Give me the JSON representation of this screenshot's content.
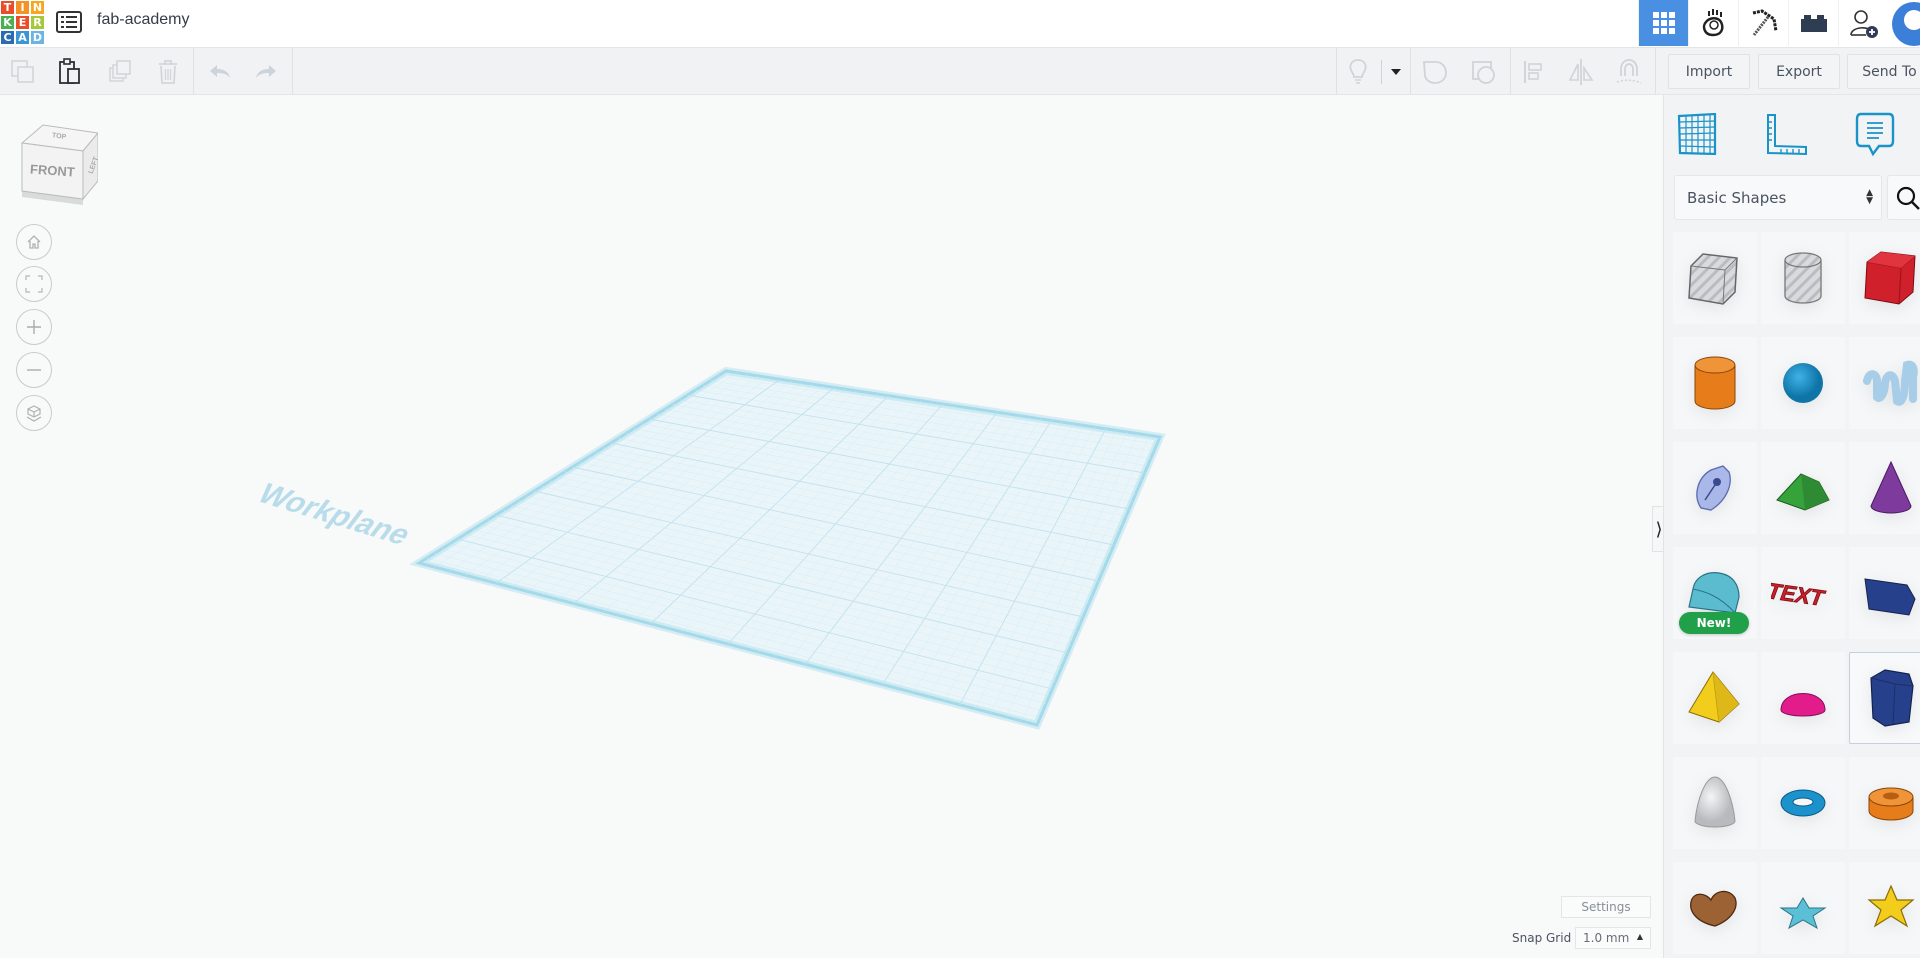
{
  "app": {
    "logo_letters": [
      "T",
      "I",
      "N",
      "K",
      "E",
      "R",
      "C",
      "A",
      "D"
    ],
    "logo_colors": [
      "#e94e2b",
      "#f49324",
      "#f5a623",
      "#4cb050",
      "#e94e2b",
      "#a5c93a",
      "#2b6cb0",
      "#3c96d6",
      "#6cb4e4"
    ],
    "project_title": "fab-academy"
  },
  "header": {
    "buttons": [
      {
        "name": "3d-design-view",
        "icon": "grid-icon",
        "active": true
      },
      {
        "name": "codeblocks-view",
        "icon": "hand-icon",
        "active": false
      },
      {
        "name": "minecraft-view",
        "icon": "pickaxe-icon",
        "active": false
      },
      {
        "name": "lego-view",
        "icon": "brick-icon",
        "active": false
      },
      {
        "name": "invite-user",
        "icon": "add-user-icon",
        "active": false
      }
    ],
    "accent_color": "#4a90e2"
  },
  "toolbar": {
    "copy": "copy",
    "paste": "paste",
    "duplicate": "duplicate",
    "delete": "delete",
    "undo": "undo",
    "redo": "redo",
    "import_label": "Import",
    "export_label": "Export",
    "send_to_label": "Send To"
  },
  "viewport": {
    "viewcube": {
      "front": "FRONT",
      "top": "TOP",
      "right": "LEFT"
    },
    "workplane_label": "Workplane",
    "controls": [
      "home-view",
      "fit-all",
      "zoom-in",
      "zoom-out",
      "ortho-perspective"
    ]
  },
  "panel": {
    "library": "Basic Shapes",
    "new_badge": "New!",
    "shapes": [
      {
        "name": "box-hole",
        "color": "#c4c7cc"
      },
      {
        "name": "cylinder-hole",
        "color": "#c4c7cc"
      },
      {
        "name": "box",
        "color": "#d0202c"
      },
      {
        "name": "cylinder",
        "color": "#e67d1a"
      },
      {
        "name": "sphere",
        "color": "#1c92cd"
      },
      {
        "name": "scribble",
        "color": "#a8cde8"
      },
      {
        "name": "shape-generator",
        "color": "#a9b8e8"
      },
      {
        "name": "roof",
        "color": "#36a23a"
      },
      {
        "name": "cone",
        "color": "#7e3a9c"
      },
      {
        "name": "round-roof",
        "color": "#5bbccf"
      },
      {
        "name": "text",
        "color": "#c8202a"
      },
      {
        "name": "wedge",
        "color": "#27408b"
      },
      {
        "name": "pyramid",
        "color": "#f2cd1c"
      },
      {
        "name": "half-sphere",
        "color": "#e21c8a"
      },
      {
        "name": "polygon",
        "color": "#27408b"
      },
      {
        "name": "paraboloid",
        "color": "#dcdedf"
      },
      {
        "name": "torus",
        "color": "#1c92cd"
      },
      {
        "name": "tube",
        "color": "#e67d1a"
      },
      {
        "name": "heart",
        "color": "#9c6234"
      },
      {
        "name": "star",
        "color": "#5bbfd6"
      },
      {
        "name": "star-extruded",
        "color": "#f2cd1c"
      }
    ]
  },
  "footer": {
    "settings_label": "Settings",
    "snap_grid_label": "Snap Grid",
    "snap_grid_value": "1.0 mm"
  }
}
